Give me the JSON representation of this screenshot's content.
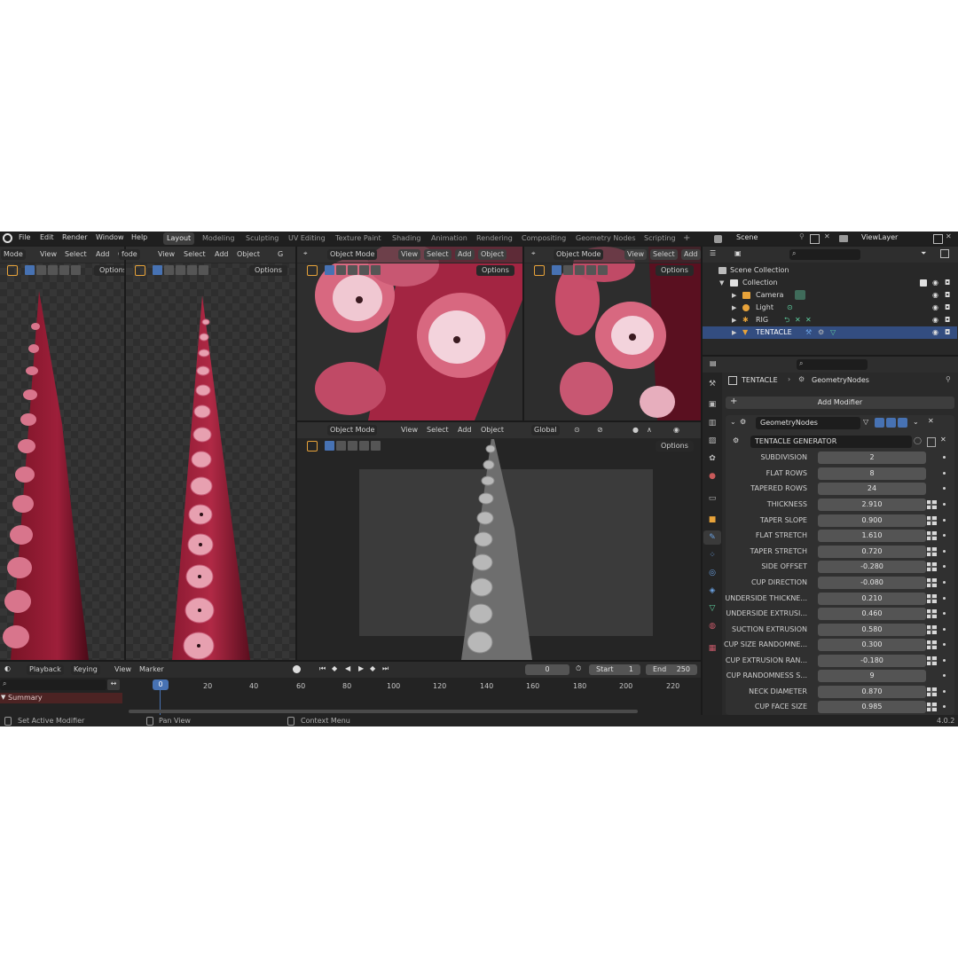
{
  "topbar": {
    "menus": [
      "File",
      "Edit",
      "Render",
      "Window",
      "Help"
    ],
    "workspaces": [
      "Layout",
      "Modeling",
      "Sculpting",
      "UV Editing",
      "Texture Paint",
      "Shading",
      "Animation",
      "Rendering",
      "Compositing",
      "Geometry Nodes",
      "Scripting"
    ],
    "active_workspace": "Layout",
    "add_tab": "+",
    "scene": "Scene",
    "view_layer": "ViewLayer"
  },
  "viewport_a": {
    "mode": "Mode",
    "menus": [
      "View",
      "Select",
      "Add",
      "O"
    ],
    "options": "Options"
  },
  "viewport_b": {
    "mode": "fode",
    "menus": [
      "View",
      "Select",
      "Add",
      "Object"
    ],
    "extra": "G",
    "options": "Options"
  },
  "viewport_c": {
    "mode": "Object Mode",
    "menus": [
      "View",
      "Select",
      "Add",
      "Object"
    ],
    "options": "Options"
  },
  "viewport_d": {
    "mode": "Object Mode",
    "menus": [
      "View",
      "Select",
      "Add"
    ],
    "options": "Options"
  },
  "viewport_e": {
    "mode": "Object Mode",
    "menus": [
      "View",
      "Select",
      "Add",
      "Object"
    ],
    "orientation": "Global",
    "options": "Options"
  },
  "timeline": {
    "menus": [
      "Playback",
      "Keying",
      "View",
      "Marker"
    ],
    "current_frame": "0",
    "start_label": "Start",
    "start": "1",
    "end_label": "End",
    "end": "250",
    "ticks": [
      "0",
      "20",
      "40",
      "60",
      "80",
      "100",
      "120",
      "140",
      "160",
      "180",
      "200",
      "220"
    ],
    "summary": "Summary"
  },
  "status": {
    "left": "Set Active Modifier",
    "middle": "Pan View",
    "right": "Context Menu",
    "version": "4.0.2"
  },
  "outliner": {
    "root": "Scene Collection",
    "collection": "Collection",
    "items": [
      {
        "label": "Camera"
      },
      {
        "label": "Light"
      },
      {
        "label": "RIG"
      },
      {
        "label": "TENTACLE"
      }
    ]
  },
  "properties": {
    "object_name": "TENTACLE",
    "modifier_crumb": "GeometryNodes",
    "add_modifier": "Add Modifier",
    "modifier_name": "GeometryNodes",
    "node_group": "TENTACLE GENERATOR",
    "params": [
      {
        "label": "SUBDIVISION",
        "value": "2"
      },
      {
        "label": "FLAT ROWS",
        "value": "8"
      },
      {
        "label": "TAPERED ROWS",
        "value": "24"
      },
      {
        "label": "THICKNESS",
        "value": "2.910"
      },
      {
        "label": "TAPER SLOPE",
        "value": "0.900"
      },
      {
        "label": "FLAT STRETCH",
        "value": "1.610"
      },
      {
        "label": "TAPER STRETCH",
        "value": "0.720"
      },
      {
        "label": "SIDE OFFSET",
        "value": "-0.280"
      },
      {
        "label": "CUP DIRECTION",
        "value": "-0.080"
      },
      {
        "label": "UNDERSIDE THICKNE...",
        "value": "0.210"
      },
      {
        "label": "UNDERSIDE EXTRUSI...",
        "value": "0.460"
      },
      {
        "label": "SUCTION EXTRUSION",
        "value": "0.580"
      },
      {
        "label": "CUP SIZE RANDOMNE...",
        "value": "0.300"
      },
      {
        "label": "CUP EXTRUSION RAN...",
        "value": "-0.180"
      },
      {
        "label": "CUP RANDOMNESS S...",
        "value": "9"
      },
      {
        "label": "NECK DIAMETER",
        "value": "0.870"
      },
      {
        "label": "CUP FACE SIZE",
        "value": "0.985"
      }
    ]
  },
  "colors": {
    "accent": "#4772b3",
    "selection": "#334d80",
    "tentacle": "#c0304e"
  }
}
